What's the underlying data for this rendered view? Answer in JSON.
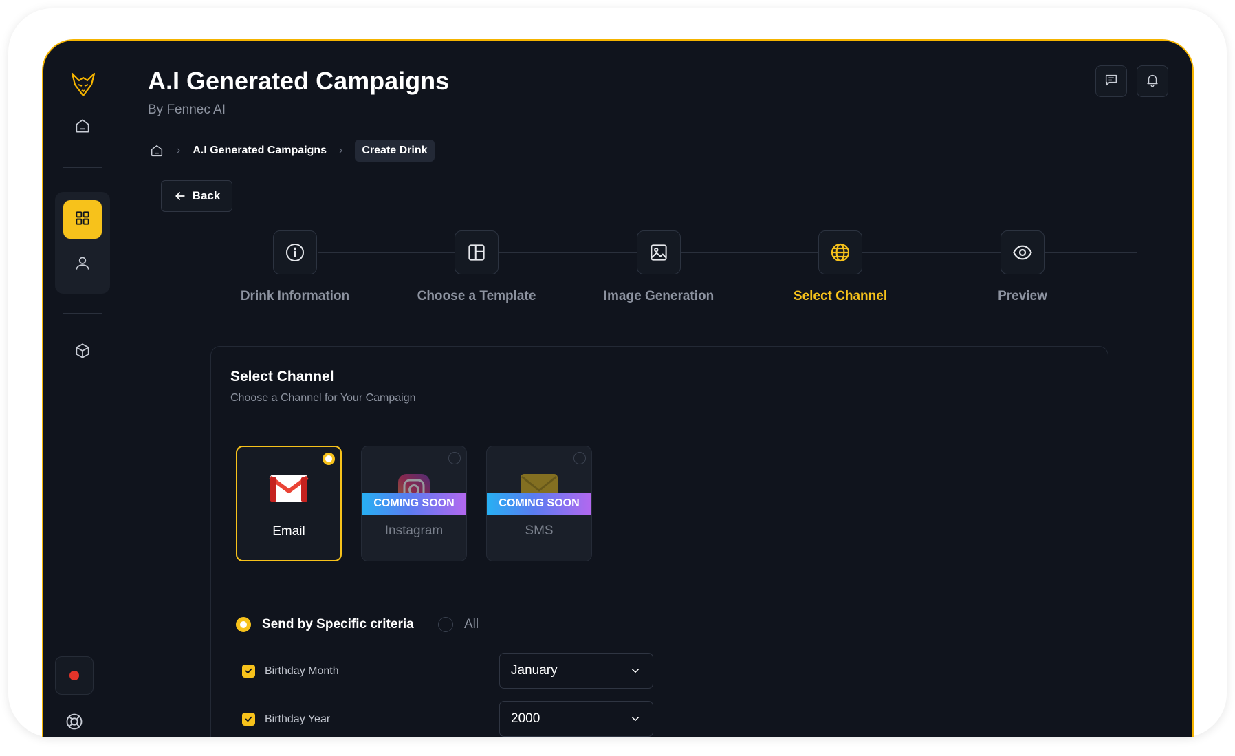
{
  "header": {
    "title": "A.I Generated Campaigns",
    "subtitle": "By Fennec AI"
  },
  "breadcrumb": {
    "items": [
      "A.I Generated Campaigns",
      "Create Drink"
    ]
  },
  "back_button": {
    "label": "Back"
  },
  "steps": [
    {
      "label": "Drink Information",
      "icon": "info-icon",
      "active": false
    },
    {
      "label": "Choose a Template",
      "icon": "layout-icon",
      "active": false
    },
    {
      "label": "Image Generation",
      "icon": "image-icon",
      "active": false
    },
    {
      "label": "Select Channel",
      "icon": "globe-icon",
      "active": true
    },
    {
      "label": "Preview",
      "icon": "eye-icon",
      "active": false
    }
  ],
  "select_channel": {
    "title": "Select Channel",
    "subtitle": "Choose a Channel for Your Campaign",
    "channels": [
      {
        "label": "Email",
        "icon": "gmail-icon",
        "selected": true,
        "badge": ""
      },
      {
        "label": "Instagram",
        "icon": "instagram-icon",
        "selected": false,
        "badge": "COMING SOON"
      },
      {
        "label": "SMS",
        "icon": "sms-icon",
        "selected": false,
        "badge": "COMING SOON"
      }
    ]
  },
  "send_options": {
    "specific": "Send by Specific criteria",
    "all": "All",
    "selected": "specific"
  },
  "criteria": [
    {
      "label": "Birthday Month",
      "checked": true,
      "value": "January"
    },
    {
      "label": "Birthday Year",
      "checked": true,
      "value": "2000"
    }
  ],
  "colors": {
    "accent": "#f7c21b",
    "background": "#10141d",
    "record": "#e5342a"
  }
}
